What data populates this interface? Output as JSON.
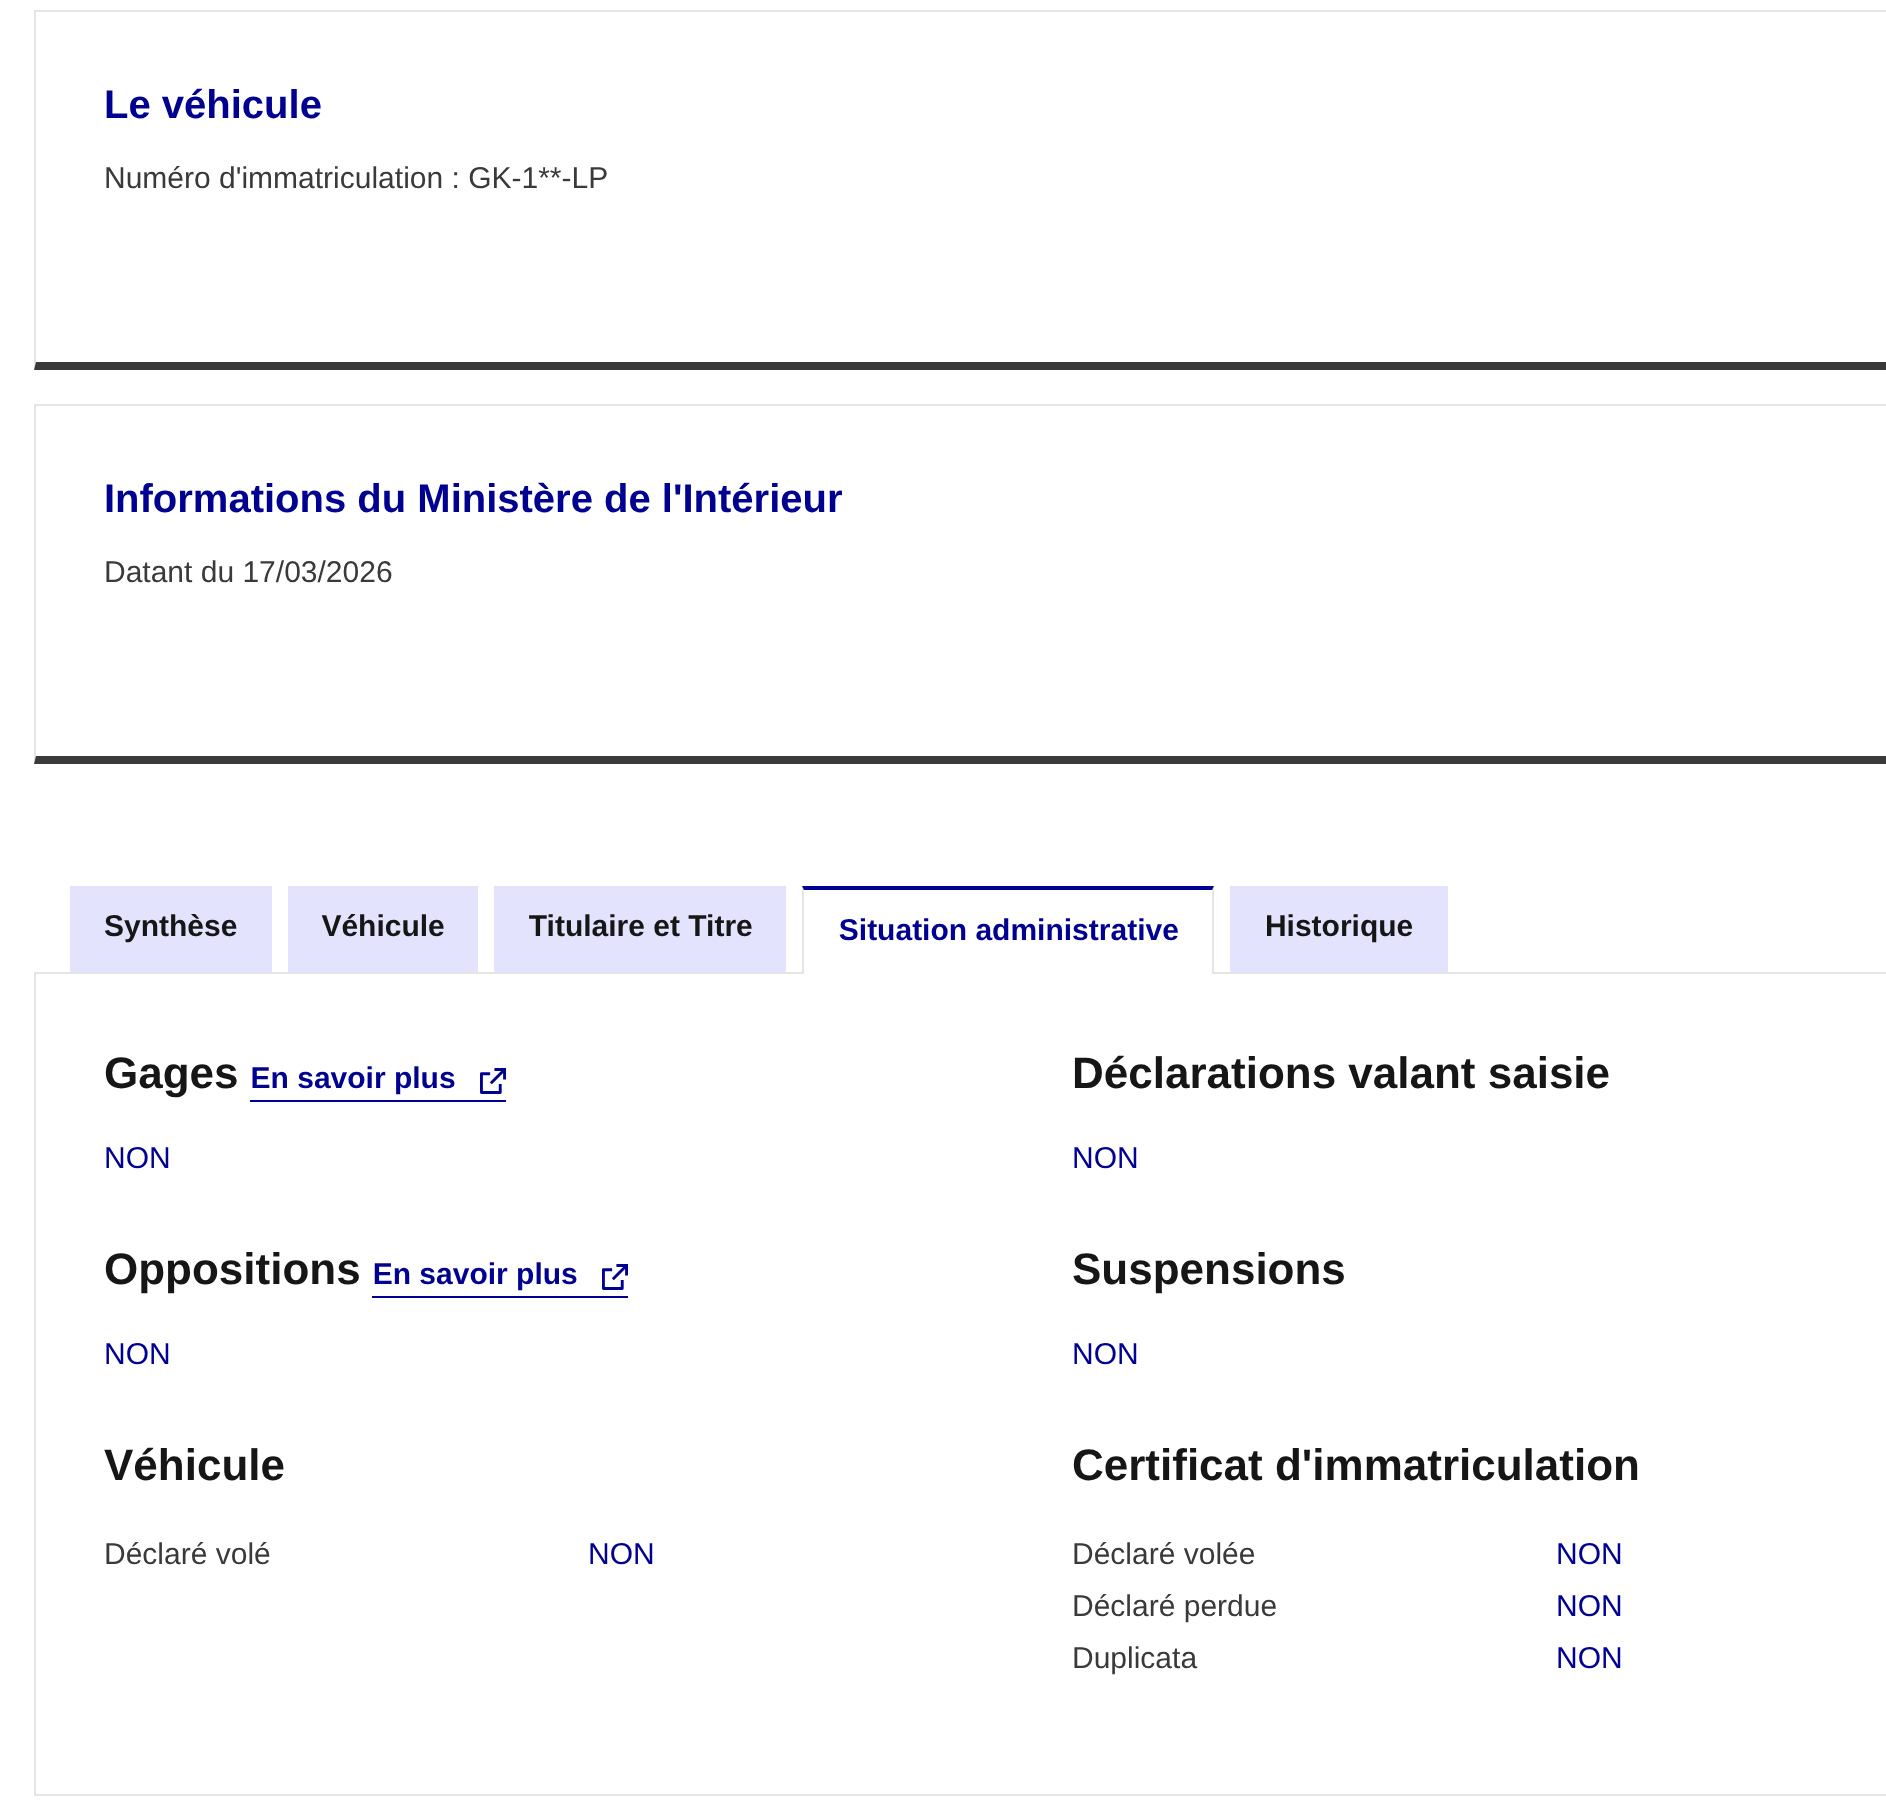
{
  "cards": [
    {
      "title": "Le véhicule",
      "subtitle": "Numéro d'immatriculation : GK-1**-LP"
    },
    {
      "title": "Informations du Ministère de l'Intérieur",
      "subtitle": "Datant du 17/03/2026"
    }
  ],
  "tabs": [
    {
      "label": "Synthèse",
      "selected": false
    },
    {
      "label": "Véhicule",
      "selected": false
    },
    {
      "label": "Titulaire et Titre",
      "selected": false
    },
    {
      "label": "Situation administrative",
      "selected": true
    },
    {
      "label": "Historique",
      "selected": false
    }
  ],
  "panel": {
    "columns": [
      [
        {
          "kind": "status",
          "title": "Gages",
          "link": "En savoir plus",
          "value": "NON"
        },
        {
          "kind": "status",
          "title": "Oppositions",
          "link": "En savoir plus",
          "value": "NON"
        },
        {
          "kind": "table",
          "title": "Véhicule",
          "rows": [
            {
              "label": "Déclaré volé",
              "value": "NON"
            }
          ]
        }
      ],
      [
        {
          "kind": "status",
          "title": "Déclarations valant saisie",
          "value": "NON"
        },
        {
          "kind": "status",
          "title": "Suspensions",
          "value": "NON"
        },
        {
          "kind": "table",
          "title": "Certificat d'immatriculation",
          "rows": [
            {
              "label": "Déclaré volée",
              "value": "NON"
            },
            {
              "label": "Déclaré perdue",
              "value": "NON"
            },
            {
              "label": "Duplicata",
              "value": "NON"
            }
          ]
        }
      ]
    ]
  }
}
